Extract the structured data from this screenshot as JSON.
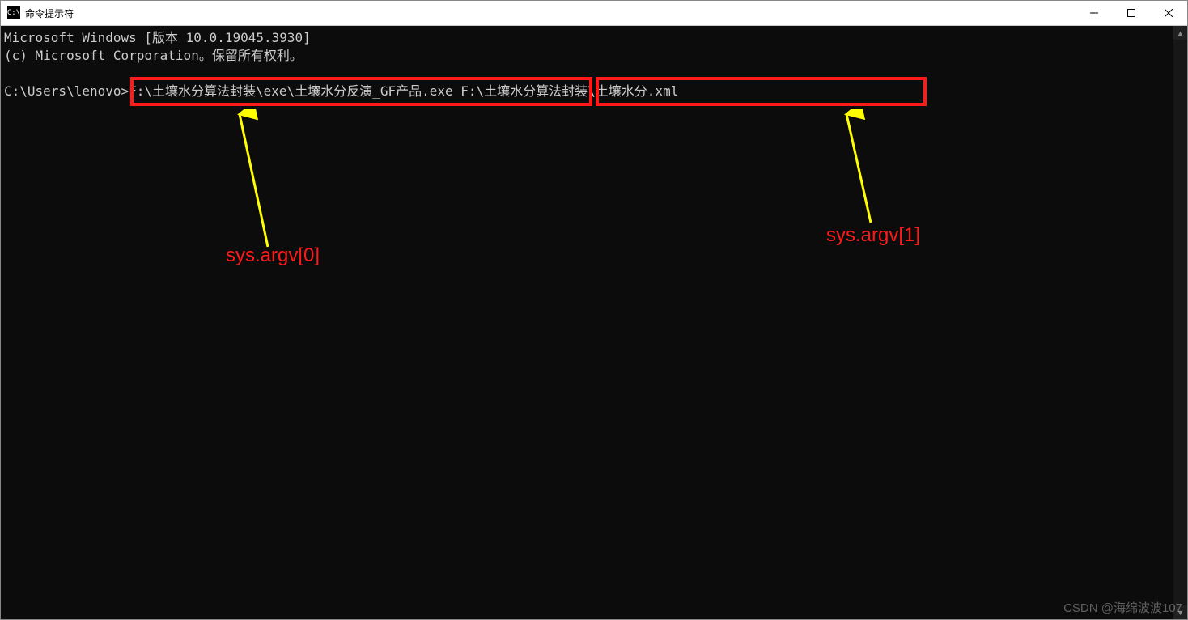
{
  "titlebar": {
    "icon_text": "C:\\",
    "title": "命令提示符"
  },
  "console": {
    "line1": "Microsoft Windows [版本 10.0.19045.3930]",
    "line2": "(c) Microsoft Corporation。保留所有权利。",
    "blank": "",
    "prompt": "C:\\Users\\lenovo>",
    "arg0": "F:\\土壤水分算法封装\\exe\\土壤水分反演_GF产品.exe",
    "arg1": "F:\\土壤水分算法封装\\土壤水分.xml"
  },
  "annotations": {
    "label0": "sys.argv[0]",
    "label1": "sys.argv[1]"
  },
  "watermark": "CSDN @海绵波波107",
  "scrollbar": {
    "up_glyph": "▲",
    "down_glyph": "▼"
  }
}
